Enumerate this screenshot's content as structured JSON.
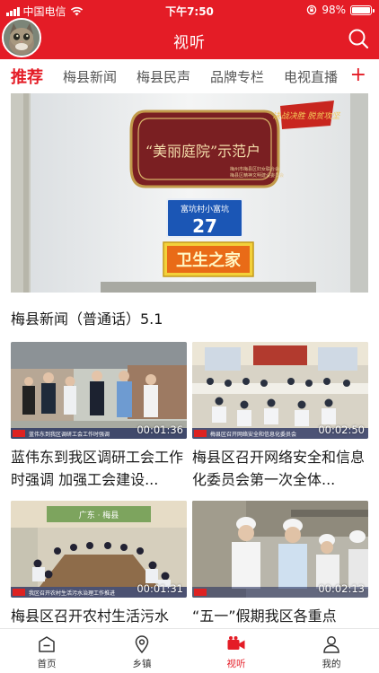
{
  "status_bar": {
    "carrier": "中国电信",
    "time": "下午7:50",
    "battery": "98%",
    "battery_level": 0.98
  },
  "header": {
    "title": "视听"
  },
  "tabs": [
    {
      "label": "推荐"
    },
    {
      "label": "梅县新闻"
    },
    {
      "label": "梅县民声"
    },
    {
      "label": "品牌专栏"
    },
    {
      "label": "电视直播"
    }
  ],
  "tab_add": "+",
  "hero": {
    "title": "梅县新闻（普通话）5.1",
    "plaque_title": "“美丽庭院”示范户",
    "plaque_sub": [
      "梅州市梅县区妇女联合会",
      "梅县区精神文明建设委员会"
    ],
    "house_village": "富坑村小富坑",
    "house_number": "27",
    "sign": "卫生之家",
    "banner": "决战决胜 脱贫攻坚"
  },
  "videos": [
    {
      "title": "蓝伟东到我区调研工会工作时强调 加强工会建设...",
      "duration": "00:01:36",
      "caption": "蓝伟东到我区调研工会工作时强调"
    },
    {
      "title": "梅县区召开网络安全和信息化委员会第一次全体...",
      "duration": "00:02:50",
      "caption": "梅县区召开网络安全和信息化委员会"
    },
    {
      "title": "梅县区召开农村生活污水",
      "duration": "00:01:31",
      "caption": "我区召开农村生活污水治理工作推进",
      "sign": "广东 · 梅县"
    },
    {
      "title": "“五一”假期我区各重点",
      "duration": "00:02:13"
    }
  ],
  "bottom_nav": [
    {
      "label": "首页",
      "icon": "home-icon"
    },
    {
      "label": "乡镇",
      "icon": "location-pin-icon"
    },
    {
      "label": "视听",
      "icon": "video-camera-icon",
      "active": true
    },
    {
      "label": "我的",
      "icon": "user-icon"
    }
  ],
  "colors": {
    "brand_red": "#e41c26",
    "text": "#1a1a1a",
    "muted": "#555555"
  }
}
